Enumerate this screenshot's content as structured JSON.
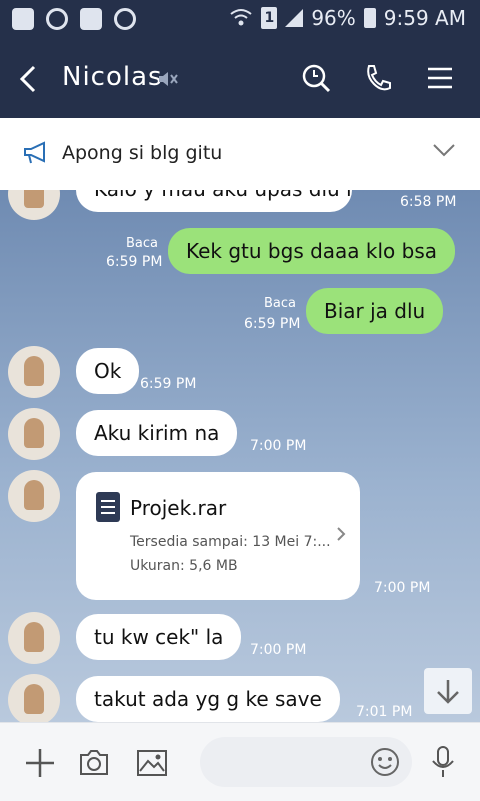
{
  "status_bar": {
    "battery": "96%",
    "sim": "1",
    "time": "9:59 AM"
  },
  "header": {
    "title": "Nicolas"
  },
  "notice": {
    "text": "Apong si blg gitu"
  },
  "messages": [
    {
      "partial": "Kalo y mau aku upas dlu ni",
      "time": "6:58 PM"
    },
    {
      "text": "Kek gtu bgs daaa klo bsa",
      "read": "Baca",
      "time": "6:59 PM"
    },
    {
      "text": "Biar ja dlu",
      "read": "Baca",
      "time": "6:59 PM"
    },
    {
      "text": "Ok",
      "time": "6:59 PM"
    },
    {
      "text": "Aku kirim na",
      "time": "7:00 PM"
    },
    {
      "file": {
        "name": "Projek.rar",
        "available": "Tersedia sampai: 13 Mei 7:...",
        "size": "Ukuran: 5,6 MB"
      },
      "time": "7:00 PM"
    },
    {
      "text": "tu kw cek\" la",
      "time": "7:00 PM"
    },
    {
      "text": "takut ada yg g ke save",
      "time": "7:01 PM"
    }
  ]
}
